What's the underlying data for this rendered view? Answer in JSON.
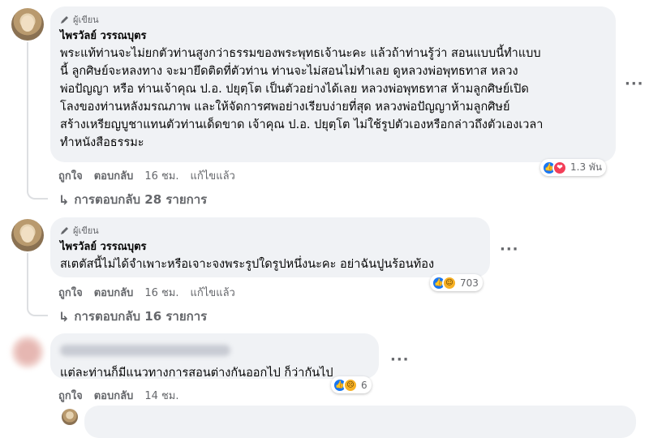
{
  "comments": [
    {
      "badge": "ผู้เขียน",
      "author": "ไพรวัลย์ วรรณบุตร",
      "lines": [
        "พระแท้ท่านจะไม่ยกตัวท่านสูงกว่าธรรมของพระพุทธเจ้านะคะ แล้วถ้าท่านรู้ว่า สอนแบบนี้ทำแบบ",
        "นี้ ลูกศิษย์จะหลงทาง จะมายึดติดที่ตัวท่าน ท่านจะไม่สอนไม่ทำเลย ดูหลวงพ่อพุทธทาส หลวง",
        "พ่อปัญญา หรือ ท่านเจ้าคุณ ป.อ. ปยุตฺโต เป็นตัวอย่างได้เลย หลวงพ่อพุทธทาส ห้ามลูกศิษย์เปิด",
        "โลงของท่านหลังมรณภาพ และให้จัดการศพอย่างเรียบง่ายที่สุด หลวงพ่อปัญญาห้ามลูกศิษย์",
        "สร้างเหรียญบูชาแทนตัวท่านเด็ดขาด เจ้าคุณ ป.อ. ปยุตฺโต ไม่ใช้รูปตัวเองหรือกล่าวถึงตัวเองเวลา",
        "ทำหนังสือธรรมะ"
      ],
      "like_label": "ถูกใจ",
      "reply_label": "ตอบกลับ",
      "time": "16 ชม.",
      "edited": "แก้ไขแล้ว",
      "reactions_count": "1.3 พัน",
      "reactions": [
        "like-icon",
        "love-icon"
      ],
      "replies_label": "การตอบกลับ 28 รายการ"
    },
    {
      "badge": "ผู้เขียน",
      "author": "ไพรวัลย์ วรรณบุตร",
      "lines": [
        "สเตตัสนี้ไม่ได้จำเพาะหรือเจาะจงพระรูปใดรูปหนึ่งนะคะ อย่าฉันปูนร้อนท้อง"
      ],
      "like_label": "ถูกใจ",
      "reply_label": "ตอบกลับ",
      "time": "16 ชม.",
      "edited": "แก้ไขแล้ว",
      "reactions_count": "703",
      "reactions": [
        "like-icon",
        "haha-icon"
      ],
      "replies_label": "การตอบกลับ 16 รายการ"
    },
    {
      "lines": [
        "แต่ละท่านก็มีแนวทางการสอนต่างกันออกไป ก็ว่ากันไป"
      ],
      "like_label": "ถูกใจ",
      "reply_label": "ตอบกลับ",
      "time": "14 ชม.",
      "reactions_count": "6",
      "reactions": [
        "like-icon",
        "sad-icon"
      ]
    }
  ],
  "more_glyph": "···"
}
